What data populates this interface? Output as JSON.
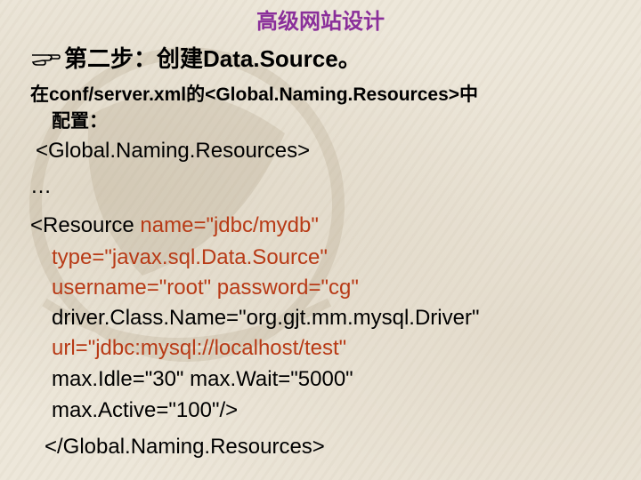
{
  "header": {
    "title": "高级网站设计"
  },
  "step": {
    "icon": "pointing-hand-icon",
    "text": "第二步：创建Data.Source。"
  },
  "instruction": {
    "line1": "在conf/server.xml的<Global.Naming.Resources>中",
    "line2": "配置："
  },
  "code": {
    "open_tag": "<Global.Naming.Resources>",
    "ellipsis": "…",
    "resource_prefix": "<Resource ",
    "name_attr": "name=\"jdbc/mydb\"",
    "type_attr": "type=\"javax.sql.Data.Source\"",
    "credentials": "username=\"root\" password=\"cg\"",
    "driver": "driver.Class.Name=\"org.gjt.mm.mysql.Driver\"",
    "url": "url=\"jdbc:mysql://localhost/test\"",
    "idle_wait": "max.Idle=\"30\" max.Wait=\"5000\"",
    "active": "max.Active=\"100\"/>",
    "close_tag": "</Global.Naming.Resources>"
  },
  "colors": {
    "title": "#8a2f9a",
    "attribute": "#b83a16",
    "text": "#000000"
  }
}
